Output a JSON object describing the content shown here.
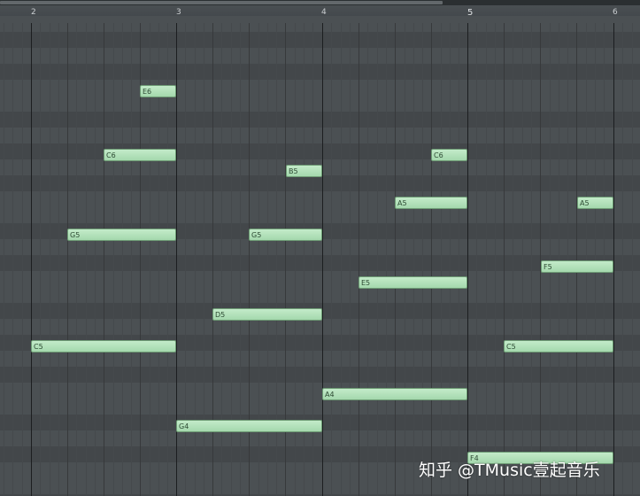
{
  "ruler": {
    "bars": [
      "2",
      "3",
      "4",
      "5",
      "6"
    ]
  },
  "notes": [
    {
      "label": "E6"
    },
    {
      "label": "C6"
    },
    {
      "label": "C6"
    },
    {
      "label": "B5"
    },
    {
      "label": "A5"
    },
    {
      "label": "A5"
    },
    {
      "label": "G5"
    },
    {
      "label": "G5"
    },
    {
      "label": "F5"
    },
    {
      "label": "E5"
    },
    {
      "label": "D5"
    },
    {
      "label": "C5"
    },
    {
      "label": "C5"
    },
    {
      "label": "A4"
    },
    {
      "label": "G4"
    },
    {
      "label": "F4"
    }
  ],
  "watermark": {
    "text": "知乎 @TMusic壹起音乐"
  }
}
